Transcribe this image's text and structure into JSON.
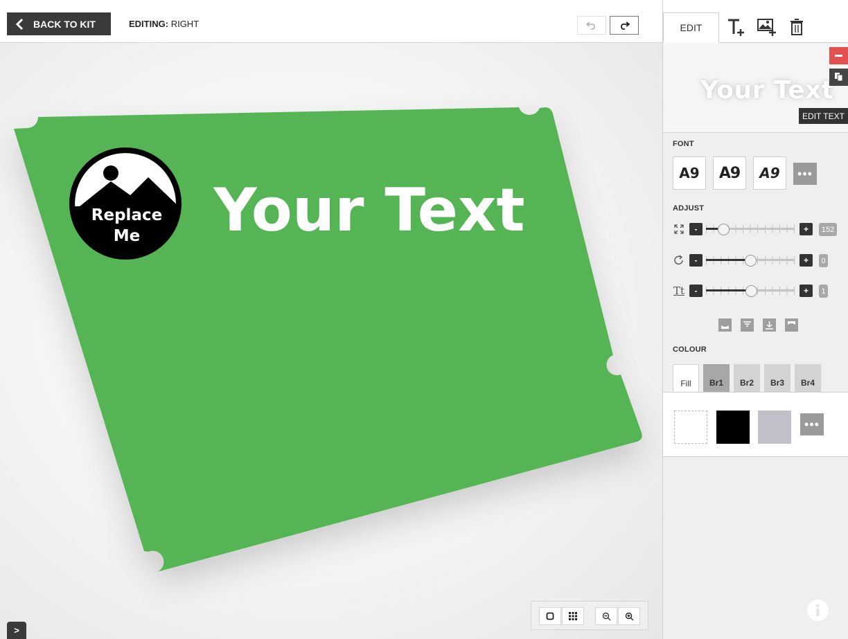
{
  "header": {
    "back_label": "BACK TO KIT",
    "editing_prefix": "EDITING:",
    "editing_value": "RIGHT"
  },
  "canvas": {
    "panel_color": "#55b554",
    "main_text": "Your Text",
    "logo_line1": "Replace",
    "logo_line2": "Me"
  },
  "panel": {
    "tab_edit": "EDIT",
    "preview_text": "Your Text",
    "edit_text_badge": "EDIT TEXT",
    "font_label": "FONT",
    "font_samples": [
      "A9",
      "A9",
      "A9"
    ],
    "more_glyph": "•••",
    "adjust_label": "ADJUST",
    "adjust": {
      "size": {
        "minus": "-",
        "plus": "+",
        "value": "152",
        "fraction": 0.15
      },
      "rotate": {
        "minus": "-",
        "plus": "+",
        "value": "0",
        "fraction": 0.5
      },
      "spacing": {
        "icon": "Tt",
        "minus": "-",
        "plus": "+",
        "value": "1",
        "fraction": 0.51
      }
    },
    "colour_label": "COLOUR",
    "colour_tabs": [
      "Fill",
      "Br1",
      "Br2",
      "Br3",
      "Br4"
    ],
    "swatch_colors": [
      "#ffffff",
      "#000000",
      "#c0c0ca"
    ],
    "accent_red": "#e25050"
  },
  "toggle_label": ">"
}
